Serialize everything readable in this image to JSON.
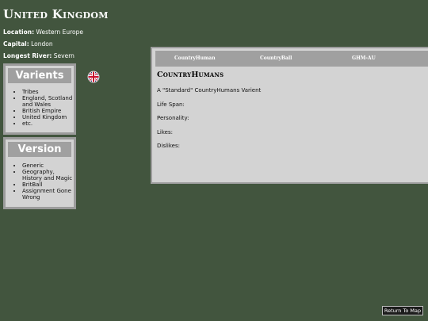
{
  "page": {
    "title": "United Kingdom"
  },
  "info": {
    "location_label": "Location:",
    "location_value": "Western Europe",
    "capital_label": "Capital:",
    "capital_value": "London",
    "river_label": "Longest River:",
    "river_value": "Severn"
  },
  "variants": {
    "header": "Varients",
    "items": [
      "Tribes",
      "England, Scotland and Wales",
      "British Empire",
      "United Kingdom",
      "etc."
    ]
  },
  "version": {
    "header": "Version",
    "items": [
      "Generic",
      "Geography, History and Magic",
      "BritBall",
      "Assignment Gone Wrong"
    ]
  },
  "flag": {
    "icon": "union-jack-icon"
  },
  "tabs": {
    "items": [
      "CountryHuman",
      "CountryBall",
      "GHM-AU"
    ]
  },
  "content": {
    "title": "CountryHumans",
    "description": "A \"Standard\" CountryHumans Varient",
    "life_span": "Life Span:",
    "personality": "Personality:",
    "likes": "Likes:",
    "dislikes": "Dislikes:"
  },
  "footer": {
    "return_label": "Return To Map"
  },
  "colors": {
    "background": "#42553e",
    "panel": "#d3d3d3",
    "panel_border": "#9c9c9c",
    "header_bar": "#a0a0a0"
  }
}
